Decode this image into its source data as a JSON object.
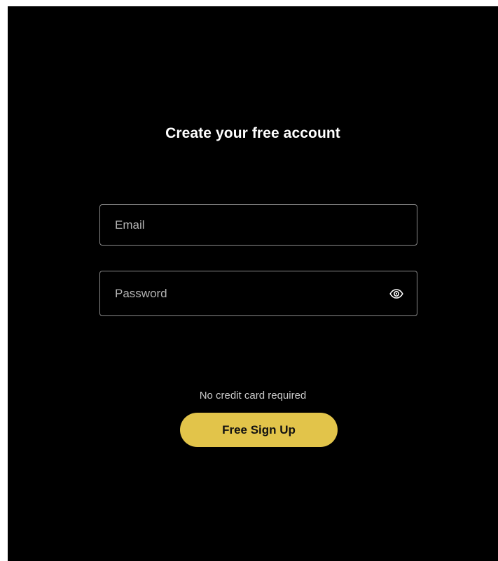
{
  "signup": {
    "title": "Create your free account",
    "email": {
      "placeholder": "Email",
      "value": ""
    },
    "password": {
      "placeholder": "Password",
      "value": "",
      "toggle_icon": "eye-icon"
    },
    "hint": "No credit card required",
    "submit_label": "Free Sign Up"
  },
  "colors": {
    "background": "#000000",
    "accent": "#e2c44a",
    "field_border": "#8a8a8a",
    "title_text": "#ffffff",
    "hint_text": "#c8c8c8"
  }
}
